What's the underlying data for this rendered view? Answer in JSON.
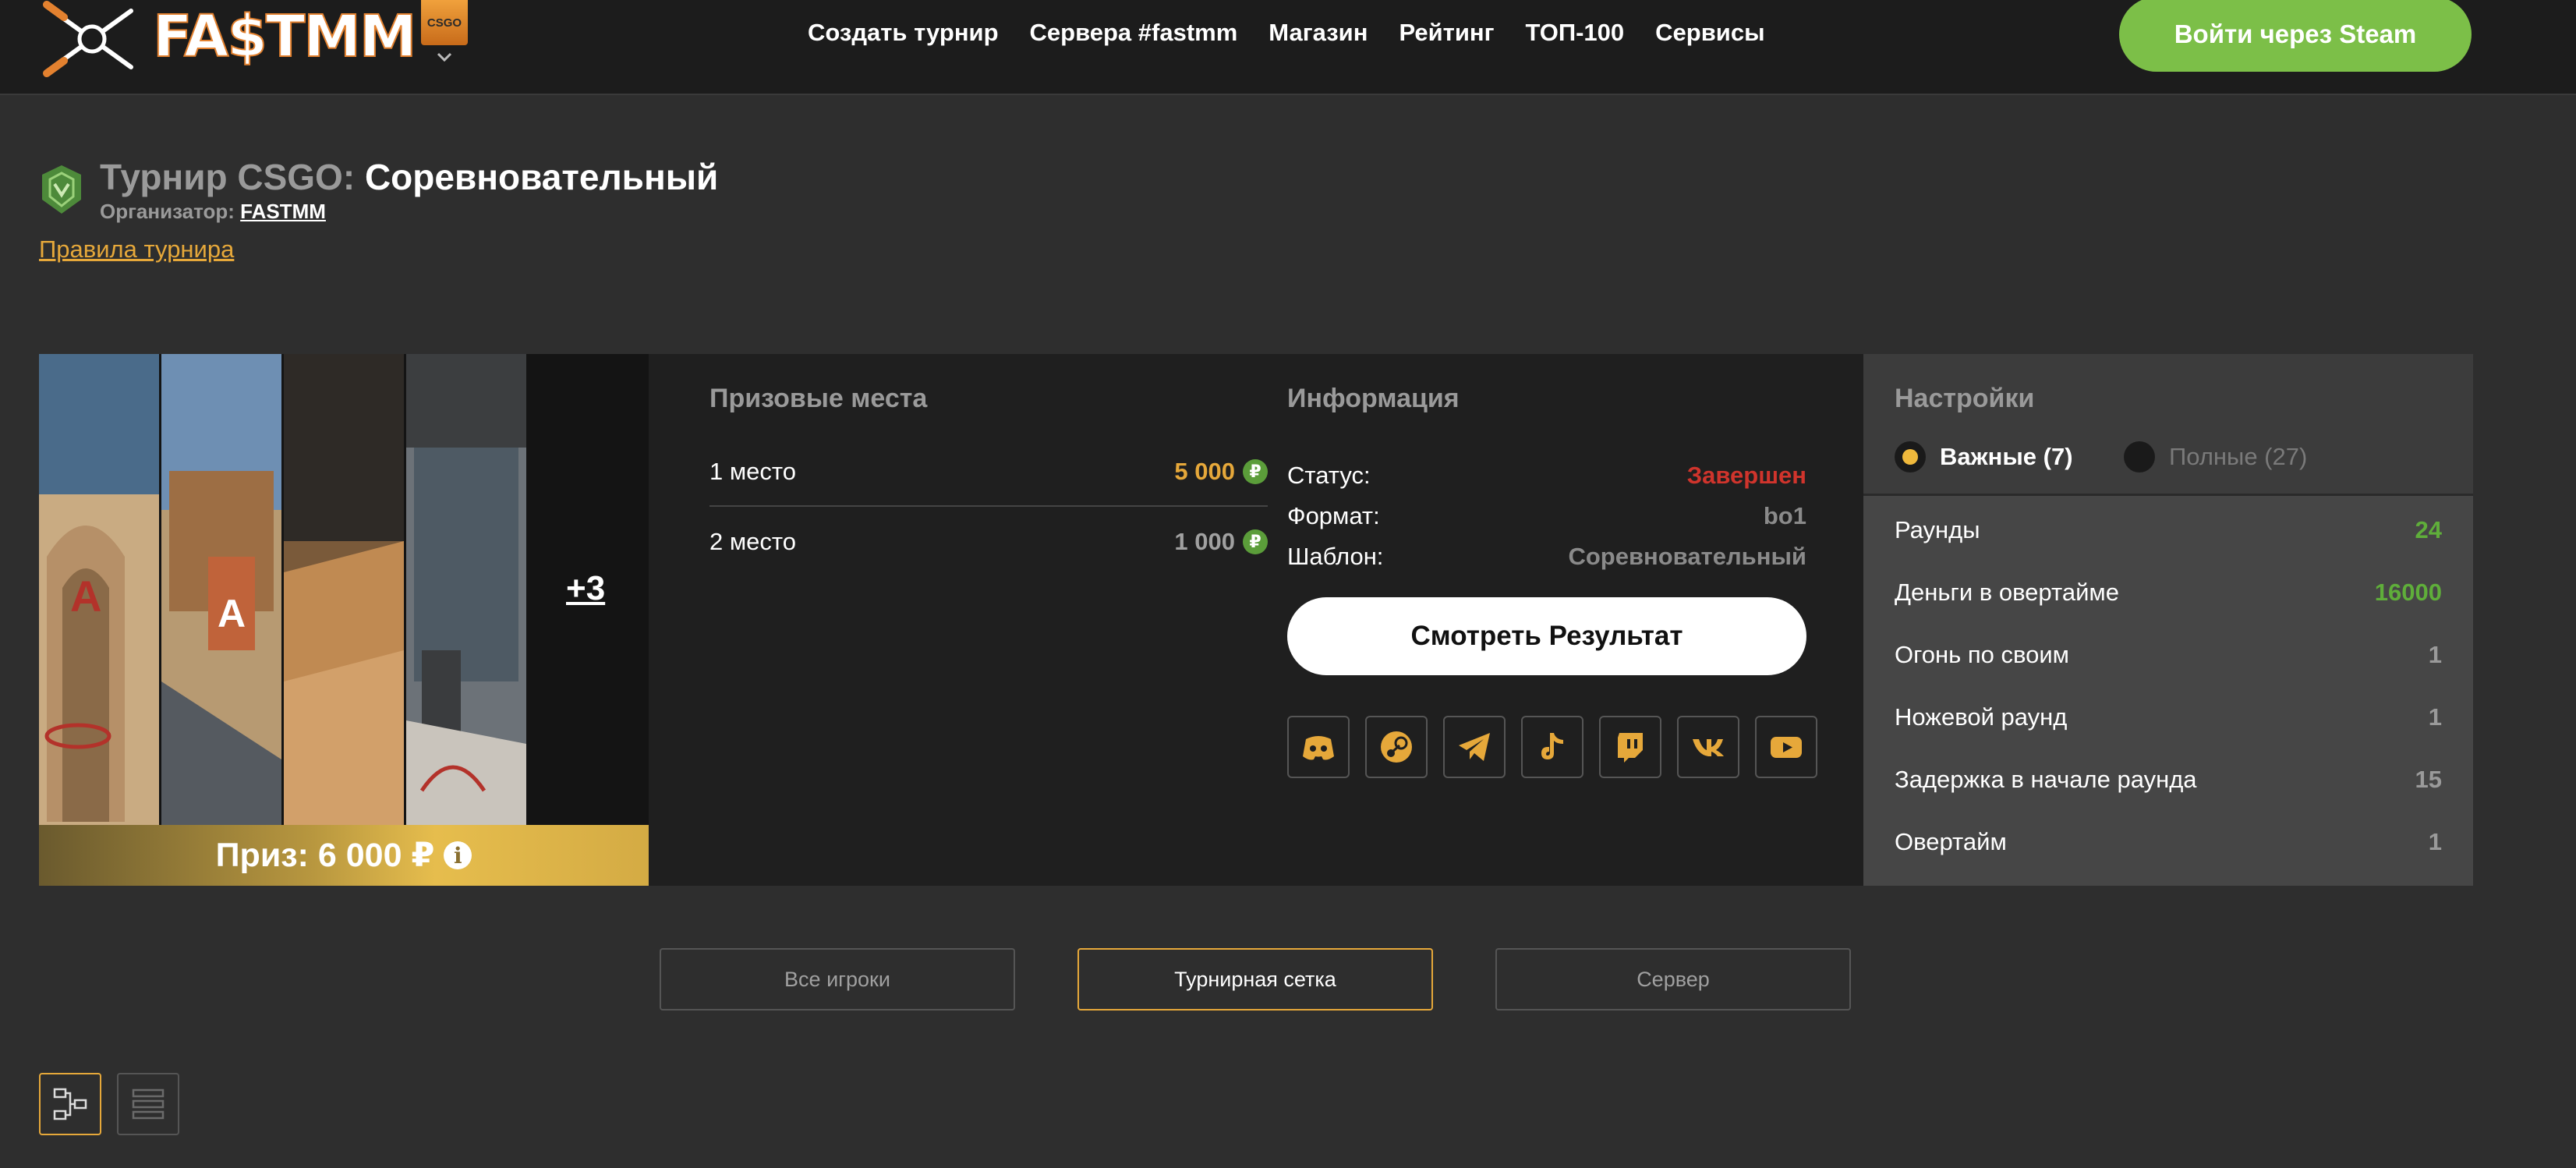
{
  "header": {
    "logo_text": "FA$TMM",
    "game_badge": "CSGO",
    "nav": [
      "Создать турнир",
      "Сервера #fastmm",
      "Магазин",
      "Рейтинг",
      "ТОП-100",
      "Сервисы"
    ],
    "login_button": "Войти через Steam"
  },
  "tournament": {
    "title_prefix": "Турнир CSGO:",
    "title_main": "Соревновательный",
    "organizer_label": "Организатор:",
    "organizer_name": "FASTMM",
    "rules_link": "Правила турнира"
  },
  "maps": {
    "more_count": "+3",
    "prize_label": "Приз: 6 000 ₽",
    "prize_info": "i"
  },
  "prizes": {
    "title": "Призовые места",
    "rows": [
      {
        "place": "1 место",
        "amount": "5 000",
        "color": "#e6a83a"
      },
      {
        "place": "2 место",
        "amount": "1 000",
        "color": "#a0a0a0"
      }
    ],
    "coin_glyph": "₽"
  },
  "info": {
    "title": "Информация",
    "rows": [
      {
        "key": "Статус:",
        "value": "Завершен",
        "color": "#d0342c"
      },
      {
        "key": "Формат:",
        "value": "bo1",
        "color": "#8a8a8a"
      },
      {
        "key": "Шаблон:",
        "value": "Соревновательный",
        "color": "#8a8a8a"
      }
    ],
    "result_button": "Смотреть Результат",
    "socials": [
      "discord-icon",
      "steam-icon",
      "telegram-icon",
      "tiktok-icon",
      "twitch-icon",
      "vk-icon",
      "youtube-icon"
    ],
    "accent": "#e6a83a"
  },
  "settings": {
    "title": "Настройки",
    "important": "Важные (7)",
    "full": "Полные (27)",
    "rows": [
      {
        "key": "Раунды",
        "value": "24",
        "color": "#5fae3a"
      },
      {
        "key": "Деньги в овертайме",
        "value": "16000",
        "color": "#5fae3a"
      },
      {
        "key": "Огонь по своим",
        "value": "1",
        "color": "#9a9a9a"
      },
      {
        "key": "Ножевой раунд",
        "value": "1",
        "color": "#9a9a9a"
      },
      {
        "key": "Задержка в начале раунда",
        "value": "15",
        "color": "#9a9a9a"
      },
      {
        "key": "Овертайм",
        "value": "1",
        "color": "#9a9a9a"
      }
    ]
  },
  "tabs": [
    "Все игроки",
    "Турнирная сетка",
    "Сервер"
  ],
  "active_tab": "Турнирная сетка",
  "colors": {
    "accent": "#e6a83a",
    "steam": "#7cbf48",
    "background": "#2e2e2e"
  }
}
